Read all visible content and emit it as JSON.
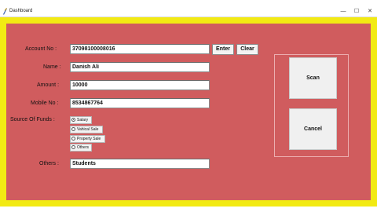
{
  "window": {
    "title": "Dashboard",
    "min_glyph": "—",
    "max_glyph": "☐",
    "close_glyph": "✕"
  },
  "colors": {
    "frame": "#f2ea13",
    "panel": "#d05c5e"
  },
  "form": {
    "account": {
      "label": "Account No :",
      "value": "37098100008016"
    },
    "name": {
      "label": "Name :",
      "value": "Danish Ali"
    },
    "amount": {
      "label": "Amount :",
      "value": "10000"
    },
    "mobile": {
      "label": "Mobile No :",
      "value": "8534867764"
    },
    "source": {
      "label": "Source Of Funds :",
      "options": [
        {
          "label": "Salary",
          "selected": true
        },
        {
          "label": "Vahical Sale",
          "selected": false
        },
        {
          "label": "Property Sale",
          "selected": false
        },
        {
          "label": "Others",
          "selected": false
        }
      ]
    },
    "others": {
      "label": "Others :",
      "value": "Students"
    }
  },
  "buttons": {
    "enter": "Enter",
    "clear": "Clear",
    "scan": "Scan",
    "cancel": "Cancel"
  }
}
